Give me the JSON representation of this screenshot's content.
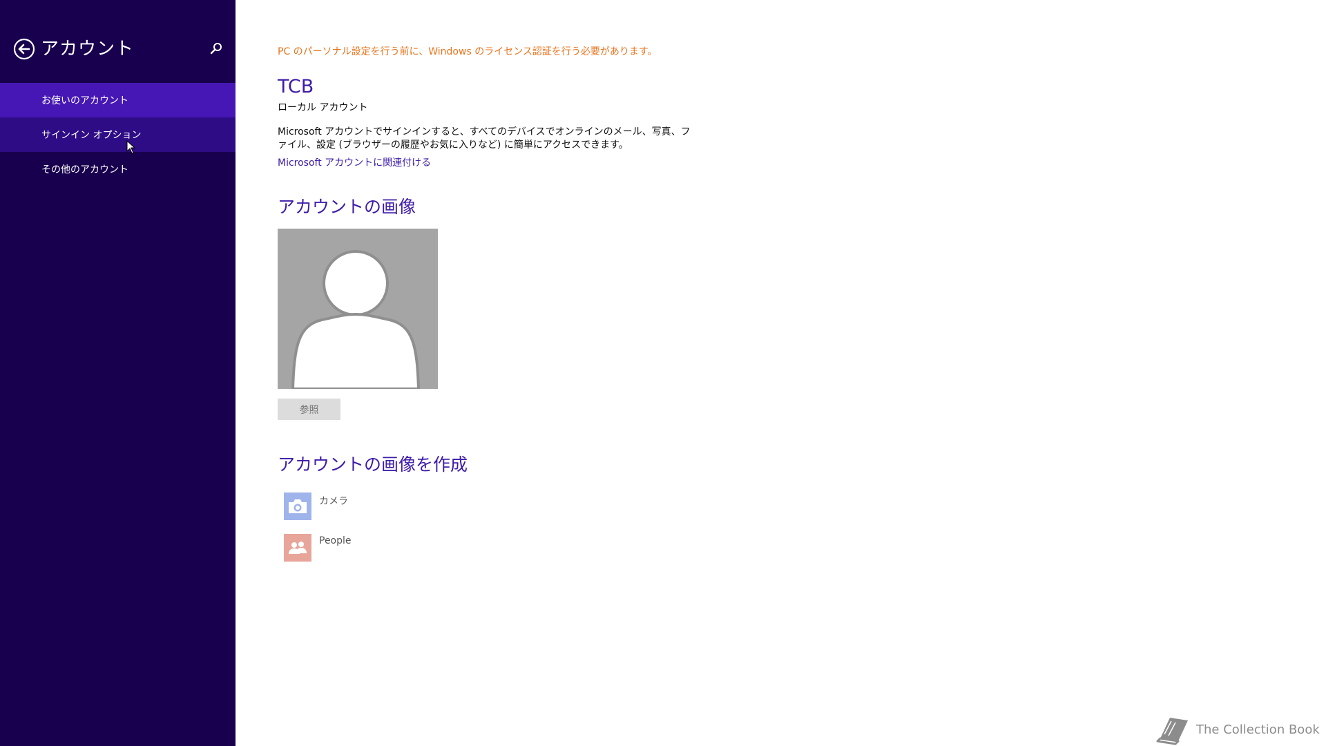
{
  "sidebar": {
    "title": "アカウント",
    "back_icon": "back-arrow-icon",
    "search_icon": "search-icon",
    "items": [
      {
        "label": "お使いのアカウント",
        "state": "selected"
      },
      {
        "label": "サインイン オプション",
        "state": "hover"
      },
      {
        "label": "その他のアカウント",
        "state": "normal"
      }
    ]
  },
  "main": {
    "license_warning": "PC のパーソナル設定を行う前に、Windows のライセンス認証を行う必要があります。",
    "account_name": "TCB",
    "account_type": "ローカル アカウント",
    "ms_description": "Microsoft アカウントでサインインすると、すべてのデバイスでオンラインのメール、写真、ファイル、設定 (ブラウザーの履歴やお気に入りなど) に簡単にアクセスできます。",
    "ms_link": "Microsoft アカウントに関連付ける",
    "picture_section_title": "アカウントの画像",
    "browse_label": "参照",
    "create_section_title": "アカウントの画像を作成",
    "apps": [
      {
        "label": "カメラ",
        "icon": "camera-icon",
        "color": "#9fb4ea"
      },
      {
        "label": "People",
        "icon": "people-icon",
        "color": "#e8a59a"
      }
    ]
  },
  "watermark": {
    "text": "The Collection Book",
    "icon": "book-icon"
  },
  "colors": {
    "sidebar_bg": "#18004e",
    "selected_bg": "#4617b4",
    "accent": "#3e1ca8",
    "warning": "#e8741e"
  }
}
